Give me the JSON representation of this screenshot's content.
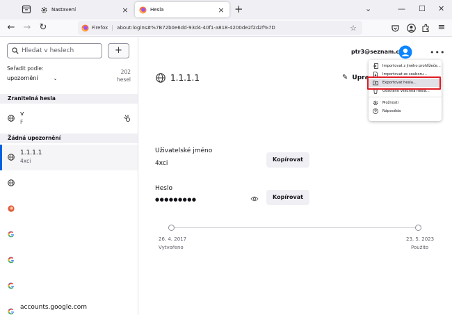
{
  "browser": {
    "tabs": [
      {
        "label": "Nastavení",
        "active": false
      },
      {
        "label": "Hesla",
        "active": true
      }
    ],
    "url_brand": "Firefox",
    "url": "about:logins#%7B72b0e6dd-93d4-40f1-a818-4200de2f2d2f%7D"
  },
  "sidebar": {
    "search_placeholder": "Hledat v heslech",
    "add_label": "+",
    "sort_label": "Seřadit podle:",
    "sort_value": "upozornění",
    "count_number": "202",
    "count_unit": "hesel",
    "group_vulnerable": "Zranitelná hesla",
    "group_none": "Žádná upozornění",
    "vulnerable_items": [
      {
        "title": "v",
        "subtitle": "F"
      }
    ],
    "items": [
      {
        "title": "1.1.1.1",
        "subtitle": "4xci",
        "icon": "globe-icon",
        "selected": true
      },
      {
        "title": "",
        "subtitle": "",
        "icon": "globe-icon"
      },
      {
        "title": "",
        "subtitle": "",
        "icon": "site-favicon-icon"
      },
      {
        "title": "",
        "subtitle": "",
        "icon": "google-icon"
      },
      {
        "title": "",
        "subtitle": "",
        "icon": "google-icon"
      },
      {
        "title": "",
        "subtitle": "",
        "icon": "google-icon"
      },
      {
        "title": "accounts.google.com",
        "subtitle": "",
        "icon": "google-icon"
      }
    ]
  },
  "main": {
    "account": "ptr3@seznam.cz",
    "menu_label": "•••",
    "site_title": "1.1.1.1",
    "edit_label": "Upra",
    "username_label": "Uživatelské jméno",
    "username_value": "4xci",
    "password_label": "Heslo",
    "password_value": "●●●●●●●●●",
    "copy_label": "Kopírovat",
    "created_date": "26. 4. 2017",
    "created_caption": "Vytvořeno",
    "used_date": "23. 5. 2023",
    "used_caption": "Použito"
  },
  "menu": {
    "items": [
      {
        "label": "Importovat z jiného prohlížeče...",
        "icon": "import-browser-icon"
      },
      {
        "label": "Importovat ze souboru...",
        "icon": "import-file-icon"
      },
      {
        "label": "Exportovat hesla...",
        "icon": "export-icon",
        "highlighted": true
      },
      {
        "label": "Odstranit všechna hesla...",
        "icon": "trash-icon"
      },
      {
        "label": "Možnosti",
        "icon": "gear-icon"
      },
      {
        "label": "Nápověda",
        "icon": "help-icon"
      }
    ]
  },
  "colors": {
    "accent": "#0061e0",
    "highlight": "#e01b24"
  }
}
